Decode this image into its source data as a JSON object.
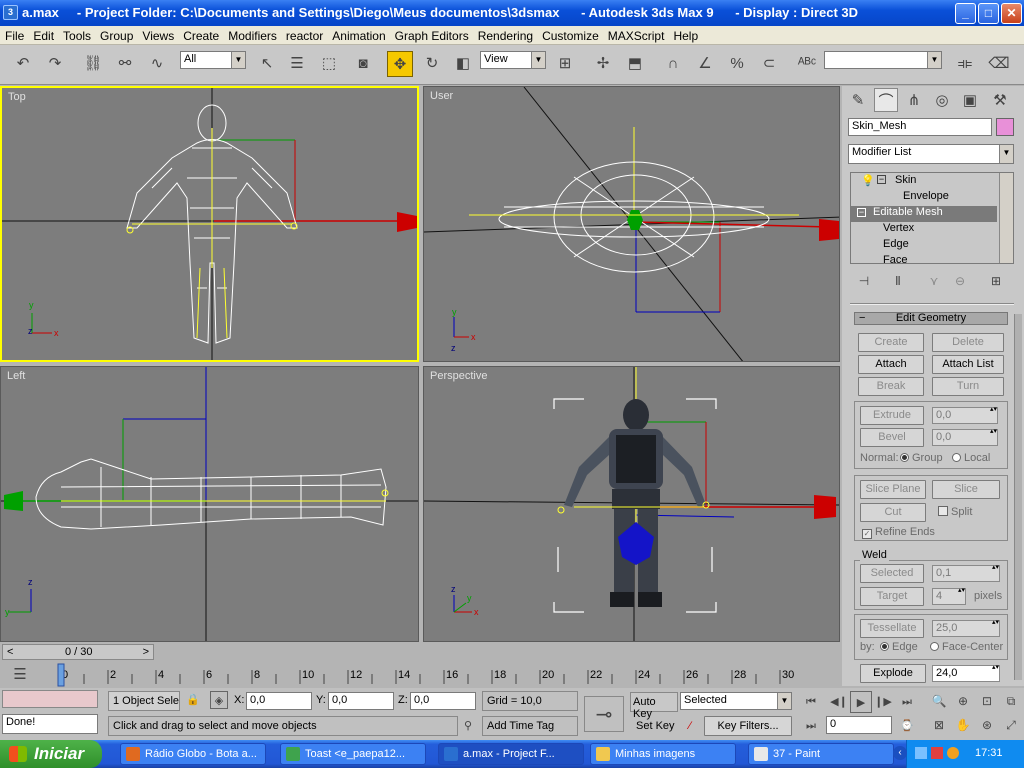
{
  "window": {
    "title": "a.max     - Project Folder: C:\\Documents and Settings\\Diego\\Meus documentos\\3dsmax      - Autodesk 3ds Max 9      - Display : Direct 3D",
    "app_icon": "3dsmax-icon",
    "buttons": {
      "minimize": "_",
      "maximize": "□",
      "close": "✕"
    }
  },
  "menu": [
    "File",
    "Edit",
    "Tools",
    "Group",
    "Views",
    "Create",
    "Modifiers",
    "reactor",
    "Animation",
    "Graph Editors",
    "Rendering",
    "Customize",
    "MAXScript",
    "Help"
  ],
  "toolbar": {
    "selection_filter": "All",
    "reference_coord": "View",
    "named_selection": ""
  },
  "viewports": {
    "top": {
      "label": "Top"
    },
    "user": {
      "label": "User"
    },
    "left": {
      "label": "Left"
    },
    "perspective": {
      "label": "Perspective"
    }
  },
  "command_panel": {
    "object_name": "Skin_Mesh",
    "object_color": "#e890d8",
    "modifier_list": "Modifier List",
    "stack": [
      {
        "label": "Skin",
        "indent": 1
      },
      {
        "label": "Envelope",
        "indent": 2
      },
      {
        "label": "Editable Mesh",
        "indent": 0,
        "selected": true
      },
      {
        "label": "Vertex",
        "indent": 1
      },
      {
        "label": "Edge",
        "indent": 1
      },
      {
        "label": "Face",
        "indent": 1
      }
    ],
    "rollout_title": "Edit Geometry",
    "buttons": {
      "create": "Create",
      "delete": "Delete",
      "attach": "Attach",
      "attach_list": "Attach List",
      "break": "Break",
      "turn": "Turn",
      "extrude": "Extrude",
      "bevel": "Bevel",
      "slice_plane": "Slice Plane",
      "slice": "Slice",
      "cut": "Cut",
      "weld_selected": "Selected",
      "weld_target": "Target",
      "tessellate": "Tessellate",
      "explode": "Explode"
    },
    "extrude_value": "0,0",
    "bevel_value": "0,0",
    "normal_label": "Normal:",
    "normal_group": "Group",
    "normal_local": "Local",
    "split_label": "Split",
    "refine_ends": "Refine Ends",
    "weld_group": "Weld",
    "weld_selected_value": "0,1",
    "weld_target_value": "4",
    "pixels_label": "pixels",
    "tessellate_value": "25,0",
    "by_label": "by:",
    "by_edge": "Edge",
    "by_face_center": "Face-Center",
    "explode_value": "24,0"
  },
  "timeline": {
    "frame_counter": "0 / 30",
    "ticks": [
      "0",
      "2",
      "4",
      "6",
      "8",
      "10",
      "12",
      "14",
      "16",
      "18",
      "20",
      "22",
      "24",
      "26",
      "28",
      "30"
    ],
    "current_frame": 0,
    "total_frames": 30
  },
  "status": {
    "script_listener": "Done!",
    "selection": "1 Object Sele",
    "x_label": "X:",
    "x": "0,0",
    "y_label": "Y:",
    "y": "0,0",
    "z_label": "Z:",
    "z": "0,0",
    "grid": "Grid = 10,0",
    "prompt": "Click and drag to select and move objects",
    "add_time_tag": "Add Time Tag",
    "auto_key": "Auto Key",
    "set_key": "Set Key",
    "key_mode": "Selected",
    "key_filters": "Key Filters...",
    "frame_field": "0"
  },
  "taskbar": {
    "start": "Iniciar",
    "tasks": [
      {
        "label": "Rádio Globo - Bota a...",
        "icon": "firefox-icon",
        "color": "#e06a20"
      },
      {
        "label": "Toast <e_paepa12...",
        "icon": "msn-icon",
        "color": "#3fa34d"
      },
      {
        "label": "a.max     - Project F...",
        "icon": "3dsmax-icon",
        "color": "#2a6fd0",
        "active": true
      },
      {
        "label": "Minhas imagens",
        "icon": "folder-icon",
        "color": "#f0c850"
      },
      {
        "label": "37 - Paint",
        "icon": "paint-icon",
        "color": "#e8e8e8"
      }
    ],
    "clock": "17:31"
  }
}
